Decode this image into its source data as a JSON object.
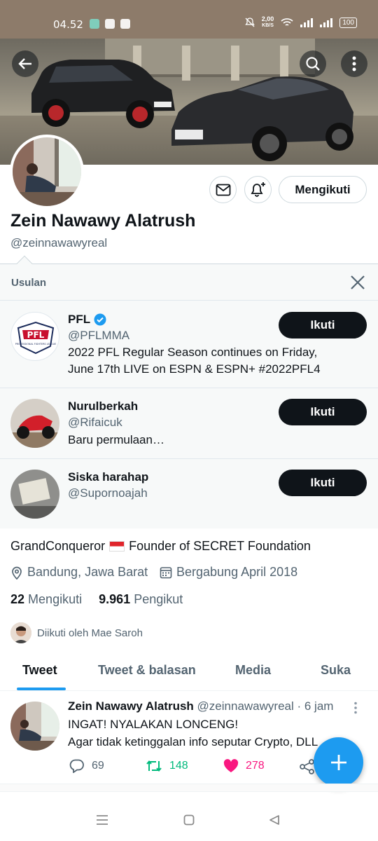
{
  "status_bar": {
    "time": "04.52",
    "speed_value": "2,00",
    "speed_unit": "KB/S",
    "battery": "100"
  },
  "profile": {
    "name": "Zein Nawawy Alatrush",
    "handle": "@zeinnawawyreal",
    "follow_state_label": "Mengikuti",
    "bio": "GrandConqueror",
    "bio_rest": "Founder of SECRET Foundation",
    "location": "Bandung, Jawa Barat",
    "joined": "Bergabung April 2018",
    "following_count": "22",
    "following_label": "Mengikuti",
    "followers_count": "9.961",
    "followers_label": "Pengikut",
    "followed_by": "Diikuti oleh Mae Saroh"
  },
  "suggestions": {
    "title": "Usulan",
    "items": [
      {
        "name": "PFL",
        "handle": "@PFLMMA",
        "verified": true,
        "bio_line1": "2022 PFL Regular Season continues on Friday,",
        "bio_line2": "June 17th LIVE on ESPN & ESPN+ #2022PFL4",
        "button": "Ikuti",
        "logo_text": "PFL",
        "logo_sub": "PROFESSIONAL FIGHTERS LEAGUE"
      },
      {
        "name": "Nurulberkah",
        "handle": "@Rifaicuk",
        "bio_line1": "Baru permulaan…",
        "button": "Ikuti"
      },
      {
        "name": "Siska harahap",
        "handle": "@Supornoajah",
        "button": "Ikuti"
      }
    ]
  },
  "tabs": [
    "Tweet",
    "Tweet & balasan",
    "Media",
    "Suka"
  ],
  "tweet": {
    "author": "Zein Nawawy Alatrush",
    "handle_time": "@zeinnawawyreal · 6 jam",
    "line1": "INGAT! NYALAKAN LONCENG!",
    "line2": "Agar tidak ketinggalan info seputar Crypto, DLL",
    "replies": "69",
    "retweets": "148",
    "likes": "278"
  },
  "colors": {
    "accent": "#1d9bf0",
    "retweet": "#00ba7c",
    "like": "#f91880",
    "text": "#0f1419",
    "muted": "#536471"
  },
  "icons": [
    "back-arrow-icon",
    "search-icon",
    "more-vertical-icon",
    "mail-icon",
    "bell-plus-icon",
    "close-icon",
    "verified-badge-icon",
    "location-pin-icon",
    "calendar-icon",
    "reply-icon",
    "retweet-icon",
    "heart-icon",
    "share-icon",
    "compose-plus-icon"
  ]
}
